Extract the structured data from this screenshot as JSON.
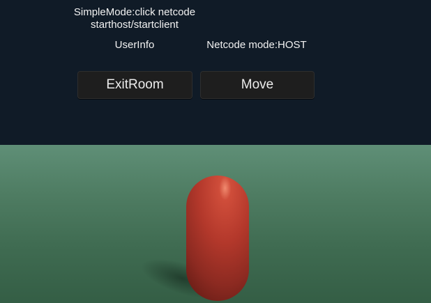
{
  "hud": {
    "hint": "SimpleMode:click netcode\nstarthost/startclient",
    "user_info": "UserInfo",
    "netcode_mode": "Netcode mode:HOST"
  },
  "buttons": {
    "exit_room": "ExitRoom",
    "move": "Move"
  },
  "colors": {
    "sky": "#101b27",
    "ground": "#4f7d63",
    "player_capsule": "#b3382b",
    "button_bg": "#1e1e1e"
  }
}
